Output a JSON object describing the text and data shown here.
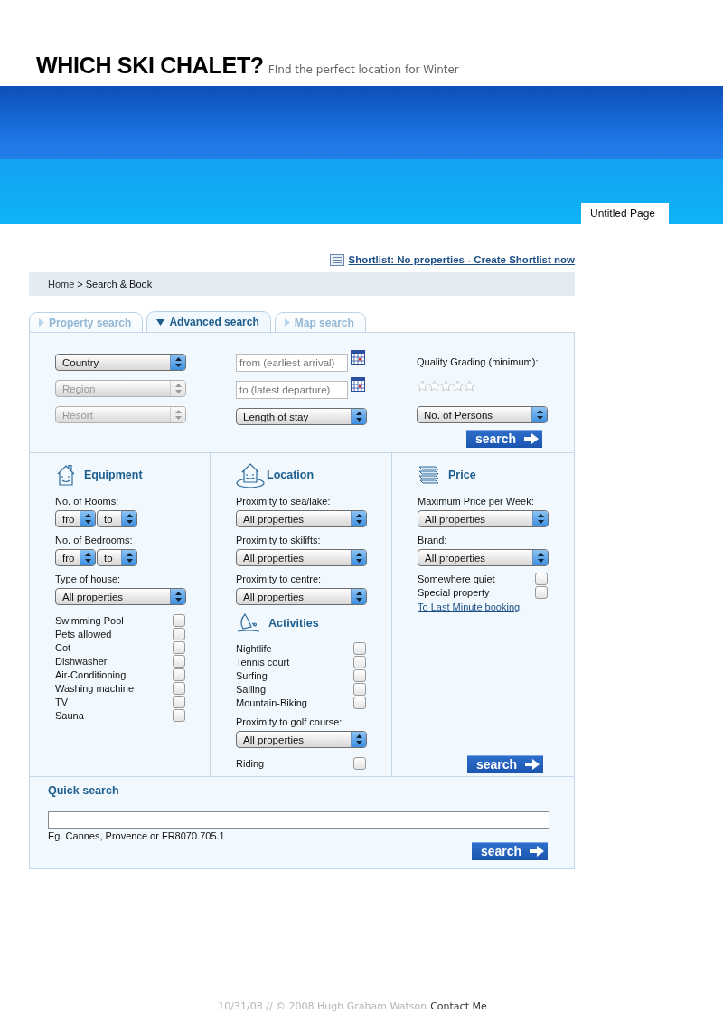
{
  "header": {
    "title": "WHICH SKI CHALET?",
    "tagline": "FInd the perfect location for Winter"
  },
  "banner": {
    "tab": "Untitled Page"
  },
  "shortlist_link": "Shortlist: No properties - Create Shortlist now",
  "breadcrumb": {
    "home": "Home",
    "separator": ">",
    "current": "Search & Book"
  },
  "tabs": [
    {
      "label": "Property search",
      "selected": false
    },
    {
      "label": "Advanced search",
      "selected": true
    },
    {
      "label": "Map search",
      "selected": false
    }
  ],
  "search_form": {
    "country": {
      "value": "Country",
      "disabled": false
    },
    "region": {
      "value": "Region",
      "disabled": true
    },
    "resort": {
      "value": "Resort",
      "disabled": true
    },
    "arrival": {
      "placeholder": "from (earliest arrival)"
    },
    "departure": {
      "placeholder": "to (latest departure)"
    },
    "length_of_stay": {
      "value": "Length of stay",
      "disabled": false
    },
    "quality": {
      "label": "Quality Grading (minimum):",
      "stars": 0
    },
    "persons": {
      "value": "No. of Persons",
      "disabled": false
    },
    "search_button": "search"
  },
  "columns": [
    {
      "items": [
        {
          "kind": "heading",
          "text": "Equipment"
        },
        {
          "kind": "label",
          "text": "No. of Rooms:"
        },
        {
          "kind": "pair",
          "values": [
            "fro",
            "to"
          ]
        },
        {
          "kind": "label",
          "text": "No. of Bedrooms:"
        },
        {
          "kind": "pair",
          "values": [
            "fro",
            "to"
          ]
        },
        {
          "kind": "label",
          "text": "Type of house:"
        },
        {
          "kind": "select",
          "value": "All properties"
        },
        {
          "kind": "checkbox",
          "text": "Swimming Pool",
          "checked": false
        },
        {
          "kind": "checkbox",
          "text": "Pets allowed",
          "checked": false
        },
        {
          "kind": "checkbox",
          "text": "Cot",
          "checked": false
        },
        {
          "kind": "checkbox",
          "text": "Dishwasher",
          "checked": false
        },
        {
          "kind": "checkbox",
          "text": "Air-Conditioning",
          "checked": false
        },
        {
          "kind": "checkbox",
          "text": "Washing machine",
          "checked": false
        },
        {
          "kind": "checkbox",
          "text": "TV",
          "checked": false
        },
        {
          "kind": "checkbox",
          "text": "Sauna",
          "checked": false
        }
      ]
    },
    {
      "items": [
        {
          "kind": "heading",
          "text": "Location"
        },
        {
          "kind": "label",
          "text": "Proximity to sea/lake:"
        },
        {
          "kind": "select",
          "value": "All properties"
        },
        {
          "kind": "label",
          "text": "Proximity to skilifts:"
        },
        {
          "kind": "select",
          "value": "All properties"
        },
        {
          "kind": "label",
          "text": "Proximity to centre:"
        },
        {
          "kind": "select",
          "value": "All properties"
        },
        {
          "kind": "heading",
          "text": "Activities"
        },
        {
          "kind": "checkbox",
          "text": "Nightlife",
          "checked": false
        },
        {
          "kind": "checkbox",
          "text": "Tennis court",
          "checked": false
        },
        {
          "kind": "checkbox",
          "text": "Surfing",
          "checked": false
        },
        {
          "kind": "checkbox",
          "text": "Sailing",
          "checked": false
        },
        {
          "kind": "checkbox",
          "text": "Mountain-Biking",
          "checked": false
        },
        {
          "kind": "label",
          "text": "Proximity to golf course:"
        },
        {
          "kind": "select",
          "value": "All properties"
        },
        {
          "kind": "checkbox",
          "text": "Riding",
          "checked": false
        }
      ]
    },
    {
      "items": [
        {
          "kind": "heading",
          "text": "Price"
        },
        {
          "kind": "label",
          "text": "Maximum Price per Week:"
        },
        {
          "kind": "select",
          "value": "All properties"
        },
        {
          "kind": "label",
          "text": "Brand:"
        },
        {
          "kind": "select",
          "value": "All properties"
        },
        {
          "kind": "checkbox",
          "text": "Somewhere quiet",
          "checked": false
        },
        {
          "kind": "checkbox",
          "text": "Special property",
          "checked": false
        },
        {
          "kind": "link",
          "text": "To Last Minute booking"
        },
        {
          "kind": "button",
          "text": "search"
        }
      ]
    }
  ],
  "quick_search": {
    "title": "Quick search",
    "hint": "Eg. Cannes, Provence or FR8070.705.1",
    "search_button": "search"
  },
  "footer": {
    "text": "10/31/08 // © 2008 Hugh Graham Watson",
    "link": "Contact Me"
  }
}
